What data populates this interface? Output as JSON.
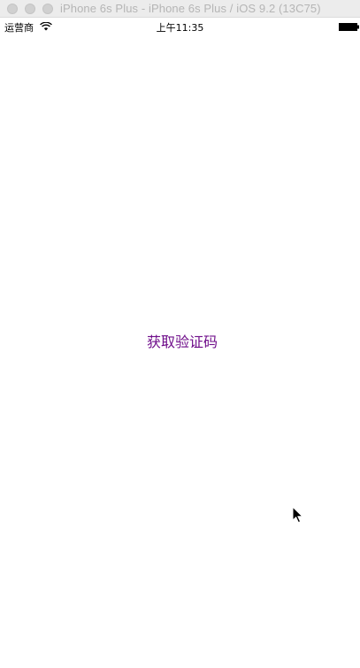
{
  "window": {
    "title": "iPhone 6s Plus - iPhone 6s Plus / iOS 9.2 (13C75)"
  },
  "status_bar": {
    "carrier": "运营商",
    "time": "上午11:35",
    "icons": [
      "wifi-icon",
      "battery-icon"
    ]
  },
  "main": {
    "get_code_button_label": "获取验证码"
  },
  "colors": {
    "button_text": "#6f0d8a",
    "background": "#ffffff"
  }
}
